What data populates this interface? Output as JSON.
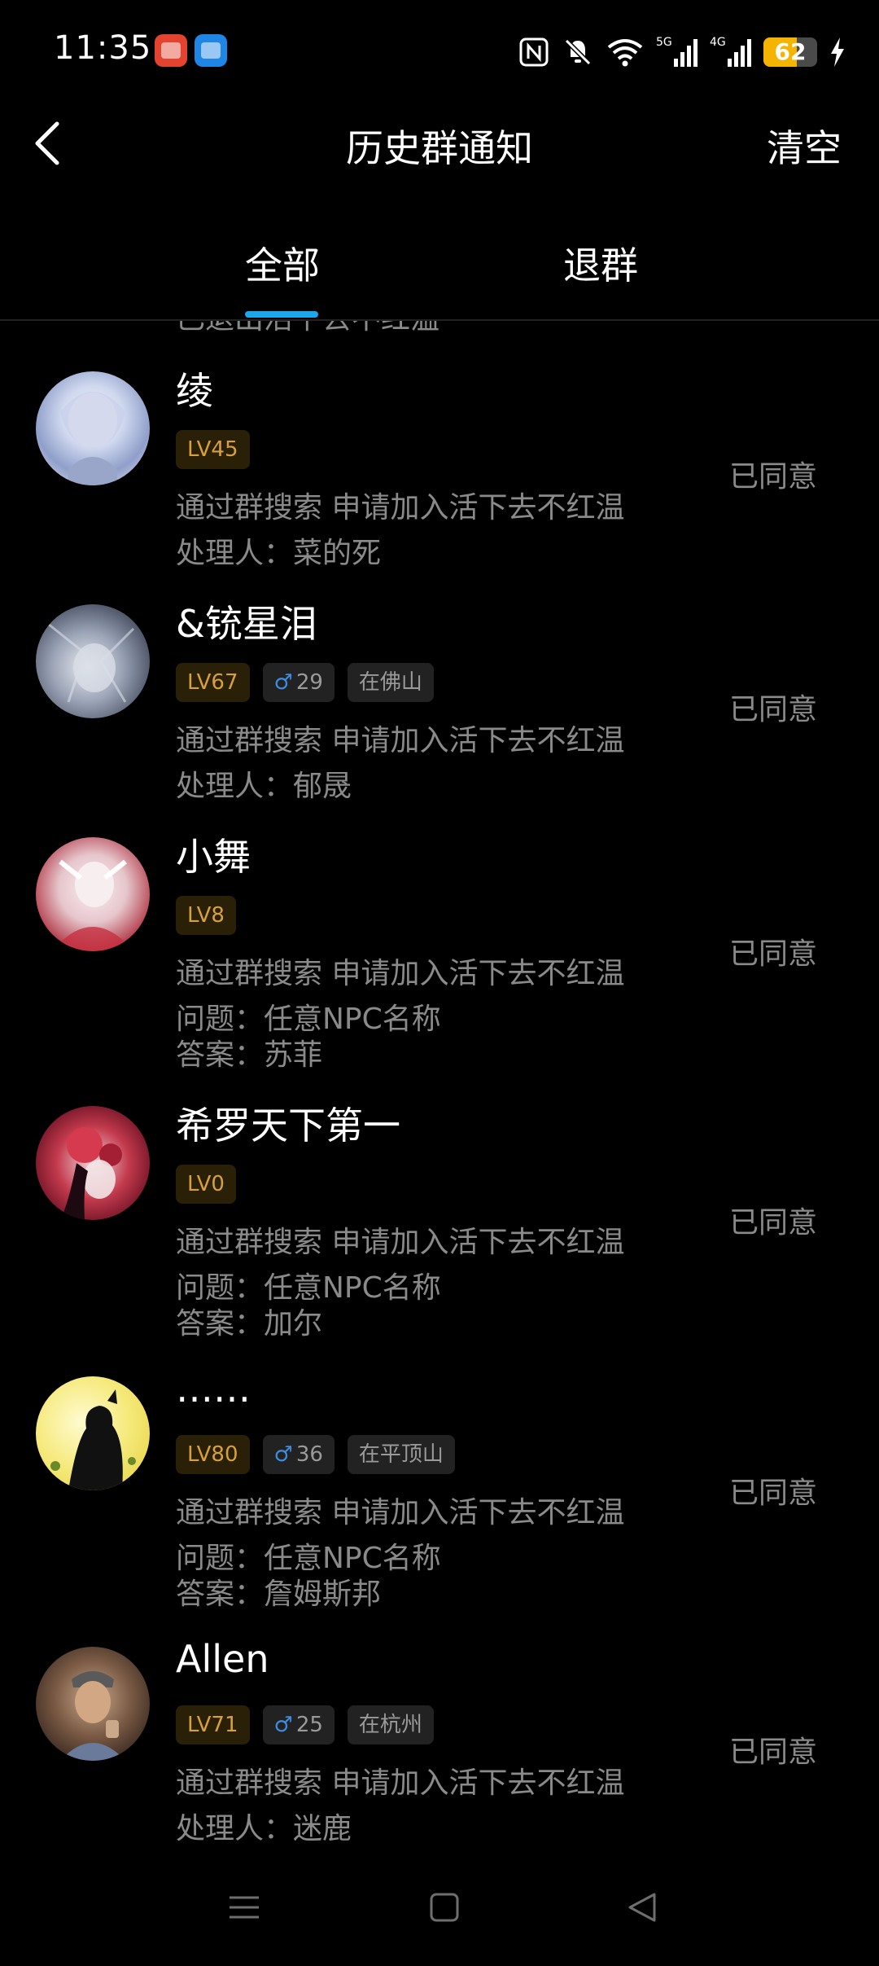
{
  "status_bar": {
    "time": "11:35",
    "battery": "62",
    "battery_level": 0.62,
    "icons": [
      "nfc-icon",
      "mute-icon",
      "wifi-icon",
      "signal-5g-icon",
      "signal-4g-icon",
      "battery-icon",
      "charging-icon"
    ],
    "network_labels": [
      "5G",
      "4G"
    ]
  },
  "header": {
    "title": "历史群通知",
    "clear_label": "清空"
  },
  "tabs": [
    {
      "label": "全部",
      "active": true
    },
    {
      "label": "退群",
      "active": false
    }
  ],
  "cut_text": "已退出活下去不红温",
  "items": [
    {
      "name": "绫",
      "level": "LV45",
      "line1": "通过群搜索 申请加入活下去不红温",
      "line2": "处理人：菜的死",
      "status": "已同意"
    },
    {
      "name": "&铳星泪",
      "level": "LV67",
      "gender": "♂",
      "age": "29",
      "location": "在佛山",
      "line1": "通过群搜索 申请加入活下去不红温",
      "line2": "处理人：郁晟",
      "status": "已同意"
    },
    {
      "name": "小舞",
      "level": "LV8",
      "line1": "通过群搜索 申请加入活下去不红温",
      "line2": "问题：任意NPC名称",
      "line3": "答案：苏菲",
      "status": "已同意"
    },
    {
      "name": "希罗天下第一",
      "level": "LV0",
      "line1": "通过群搜索 申请加入活下去不红温",
      "line2": "问题：任意NPC名称",
      "line3": "答案：加尔",
      "status": "已同意"
    },
    {
      "name": "……",
      "level": "LV80",
      "gender": "♂",
      "age": "36",
      "location": "在平顶山",
      "line1": "通过群搜索 申请加入活下去不红温",
      "line2": "问题：任意NPC名称",
      "line3": "答案：詹姆斯邦",
      "status": "已同意"
    },
    {
      "name": "Allen",
      "level": "LV71",
      "gender": "♂",
      "age": "25",
      "location": "在杭州",
      "line1": "通过群搜索 申请加入活下去不红温",
      "line2": "处理人：迷鹿",
      "status": "已同意"
    }
  ],
  "colors": {
    "accent": "#1aa7ee",
    "level_text": "#d6a03a",
    "level_bg": "#2a1f07",
    "muted_text": "#8a8a8a",
    "gender_blue": "#3d8ce0"
  },
  "system_nav": [
    "menu-icon",
    "home-icon",
    "back-triangle-icon"
  ]
}
